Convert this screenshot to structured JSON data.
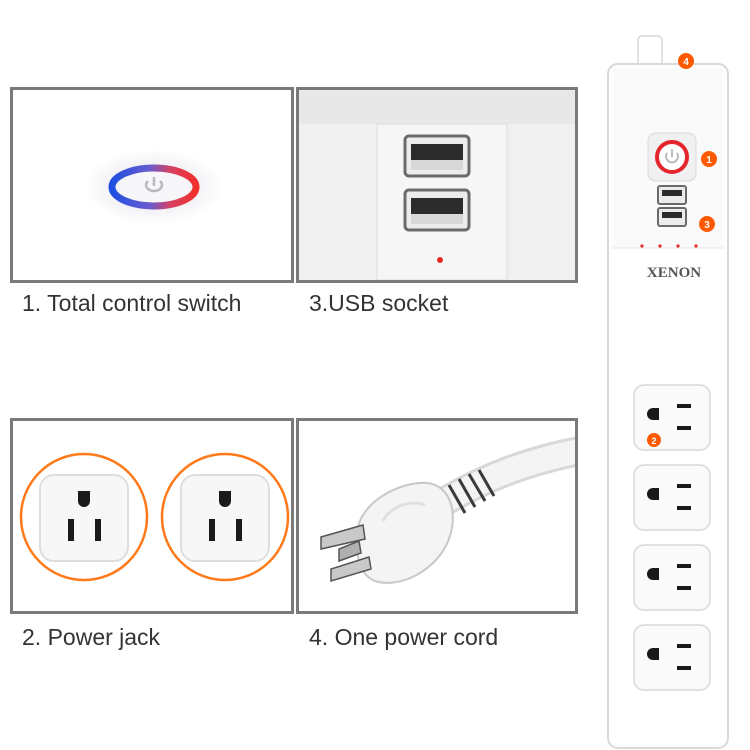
{
  "captions": {
    "total_control_switch": "1. Total control switch",
    "usb_socket": "3.USB socket",
    "power_jack": "2. Power jack",
    "power_cord": "4. One power cord"
  },
  "brand": "XENON",
  "callouts": {
    "cord": "4",
    "switch": "1",
    "usb": "3",
    "outlet": "2"
  },
  "colors": {
    "callout": "#ff5a00",
    "switch_ring": "#e3262c",
    "switch_glow_blue": "#2a5bd8",
    "outlet_ring": "#ff7a1a",
    "panel_border": "#7a7a7a"
  }
}
